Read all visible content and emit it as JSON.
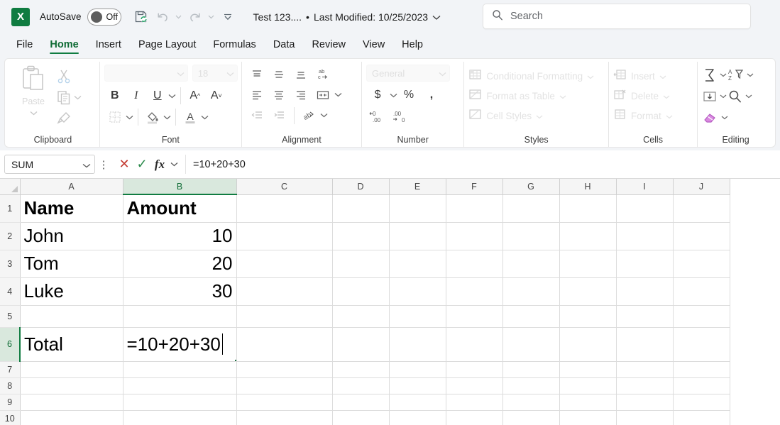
{
  "titlebar": {
    "app_logo": "X",
    "autosave_label": "AutoSave",
    "autosave_state": "Off",
    "document_title": "Test 123....",
    "separator": "•",
    "last_modified": "Last Modified: 10/25/2023",
    "qat": [
      {
        "name": "save-icon",
        "label": "Save"
      },
      {
        "name": "undo-icon",
        "label": "Undo"
      },
      {
        "name": "redo-icon",
        "label": "Redo"
      },
      {
        "name": "customize-quick-access-toolbar-icon",
        "label": "Customize Quick Access Toolbar"
      }
    ],
    "search_placeholder": "Search"
  },
  "tabs": [
    {
      "label": "File",
      "active": false
    },
    {
      "label": "Home",
      "active": true
    },
    {
      "label": "Insert",
      "active": false
    },
    {
      "label": "Page Layout",
      "active": false
    },
    {
      "label": "Formulas",
      "active": false
    },
    {
      "label": "Data",
      "active": false
    },
    {
      "label": "Review",
      "active": false
    },
    {
      "label": "View",
      "active": false
    },
    {
      "label": "Help",
      "active": false
    }
  ],
  "ribbon": {
    "clipboard": {
      "group_label": "Clipboard",
      "paste_label": "Paste",
      "cut_label": "Cut",
      "copy_label": "Copy",
      "format_painter_label": "Format Painter"
    },
    "font": {
      "group_label": "Font",
      "font_name": "",
      "font_size": "18",
      "bold": "B",
      "italic": "I",
      "underline": "U",
      "increase_font": "A",
      "decrease_font": "A",
      "borders_label": "Borders",
      "fill_color_label": "Fill Color",
      "font_color_label": "Font Color"
    },
    "alignment": {
      "group_label": "Alignment",
      "top_align": "Top Align",
      "middle_align": "Middle Align",
      "bottom_align": "Bottom Align",
      "wrap_text": "Wrap Text",
      "align_left": "Align Left",
      "center": "Center",
      "align_right": "Align Right",
      "merge_center": "Merge & Center",
      "decrease_indent": "Decrease Indent",
      "increase_indent": "Increase Indent",
      "orientation": "Orientation"
    },
    "number": {
      "group_label": "Number",
      "format": "General",
      "accounting": "$",
      "percent": "%",
      "comma": ",",
      "increase_decimal": "Increase Decimal",
      "decrease_decimal": "Decrease Decimal"
    },
    "styles": {
      "group_label": "Styles",
      "items": [
        {
          "label": "Conditional Formatting",
          "icon": "conditional-formatting-icon"
        },
        {
          "label": "Format as Table",
          "icon": "format-as-table-icon"
        },
        {
          "label": "Cell Styles",
          "icon": "cell-styles-icon"
        }
      ]
    },
    "cells": {
      "group_label": "Cells",
      "items": [
        {
          "label": "Insert",
          "icon": "insert-cells-icon"
        },
        {
          "label": "Delete",
          "icon": "delete-cells-icon"
        },
        {
          "label": "Format",
          "icon": "format-cells-icon"
        }
      ]
    },
    "editing": {
      "group_label": "Editing",
      "autosum": "Σ",
      "sort_filter": "Sort & Filter",
      "fill": "Fill",
      "find_select": "Find & Select",
      "clear": "Clear"
    }
  },
  "formula_bar": {
    "name_box": "SUM",
    "cancel": "✕",
    "enter": "✓",
    "fx": "fx",
    "formula": "=10+20+30"
  },
  "grid": {
    "columns": [
      "A",
      "B",
      "C",
      "D",
      "E",
      "F",
      "G",
      "H",
      "I",
      "J"
    ],
    "selected_column": "B",
    "selected_row": 6,
    "active_cell": "B6",
    "rows": [
      {
        "num": "1",
        "cells": {
          "A": "Name",
          "B": "Amount"
        },
        "bold": true
      },
      {
        "num": "2",
        "cells": {
          "A": "John",
          "B": "10"
        },
        "bold": false
      },
      {
        "num": "3",
        "cells": {
          "A": "Tom",
          "B": "20"
        },
        "bold": false
      },
      {
        "num": "4",
        "cells": {
          "A": "Luke",
          "B": "30"
        },
        "bold": false
      },
      {
        "num": "5",
        "cells": {
          "A": "",
          "B": ""
        },
        "bold": false
      },
      {
        "num": "6",
        "cells": {
          "A": "Total",
          "B": "=10+20+30"
        },
        "bold": false
      },
      {
        "num": "7",
        "cells": {
          "A": "",
          "B": ""
        },
        "bold": false
      },
      {
        "num": "8",
        "cells": {
          "A": "",
          "B": ""
        },
        "bold": false
      },
      {
        "num": "9",
        "cells": {
          "A": "",
          "B": ""
        },
        "bold": false
      },
      {
        "num": "10",
        "cells": {
          "A": "",
          "B": ""
        },
        "bold": false
      }
    ],
    "editing_value": "=10+20+30"
  },
  "colors": {
    "excel_green": "#107c41",
    "selection_green": "#217346",
    "header_bg": "#f5f5f5",
    "chrome_bg": "#f2f4f7",
    "cancel_red": "#c43a31",
    "confirm_green": "#2b8a4b"
  }
}
